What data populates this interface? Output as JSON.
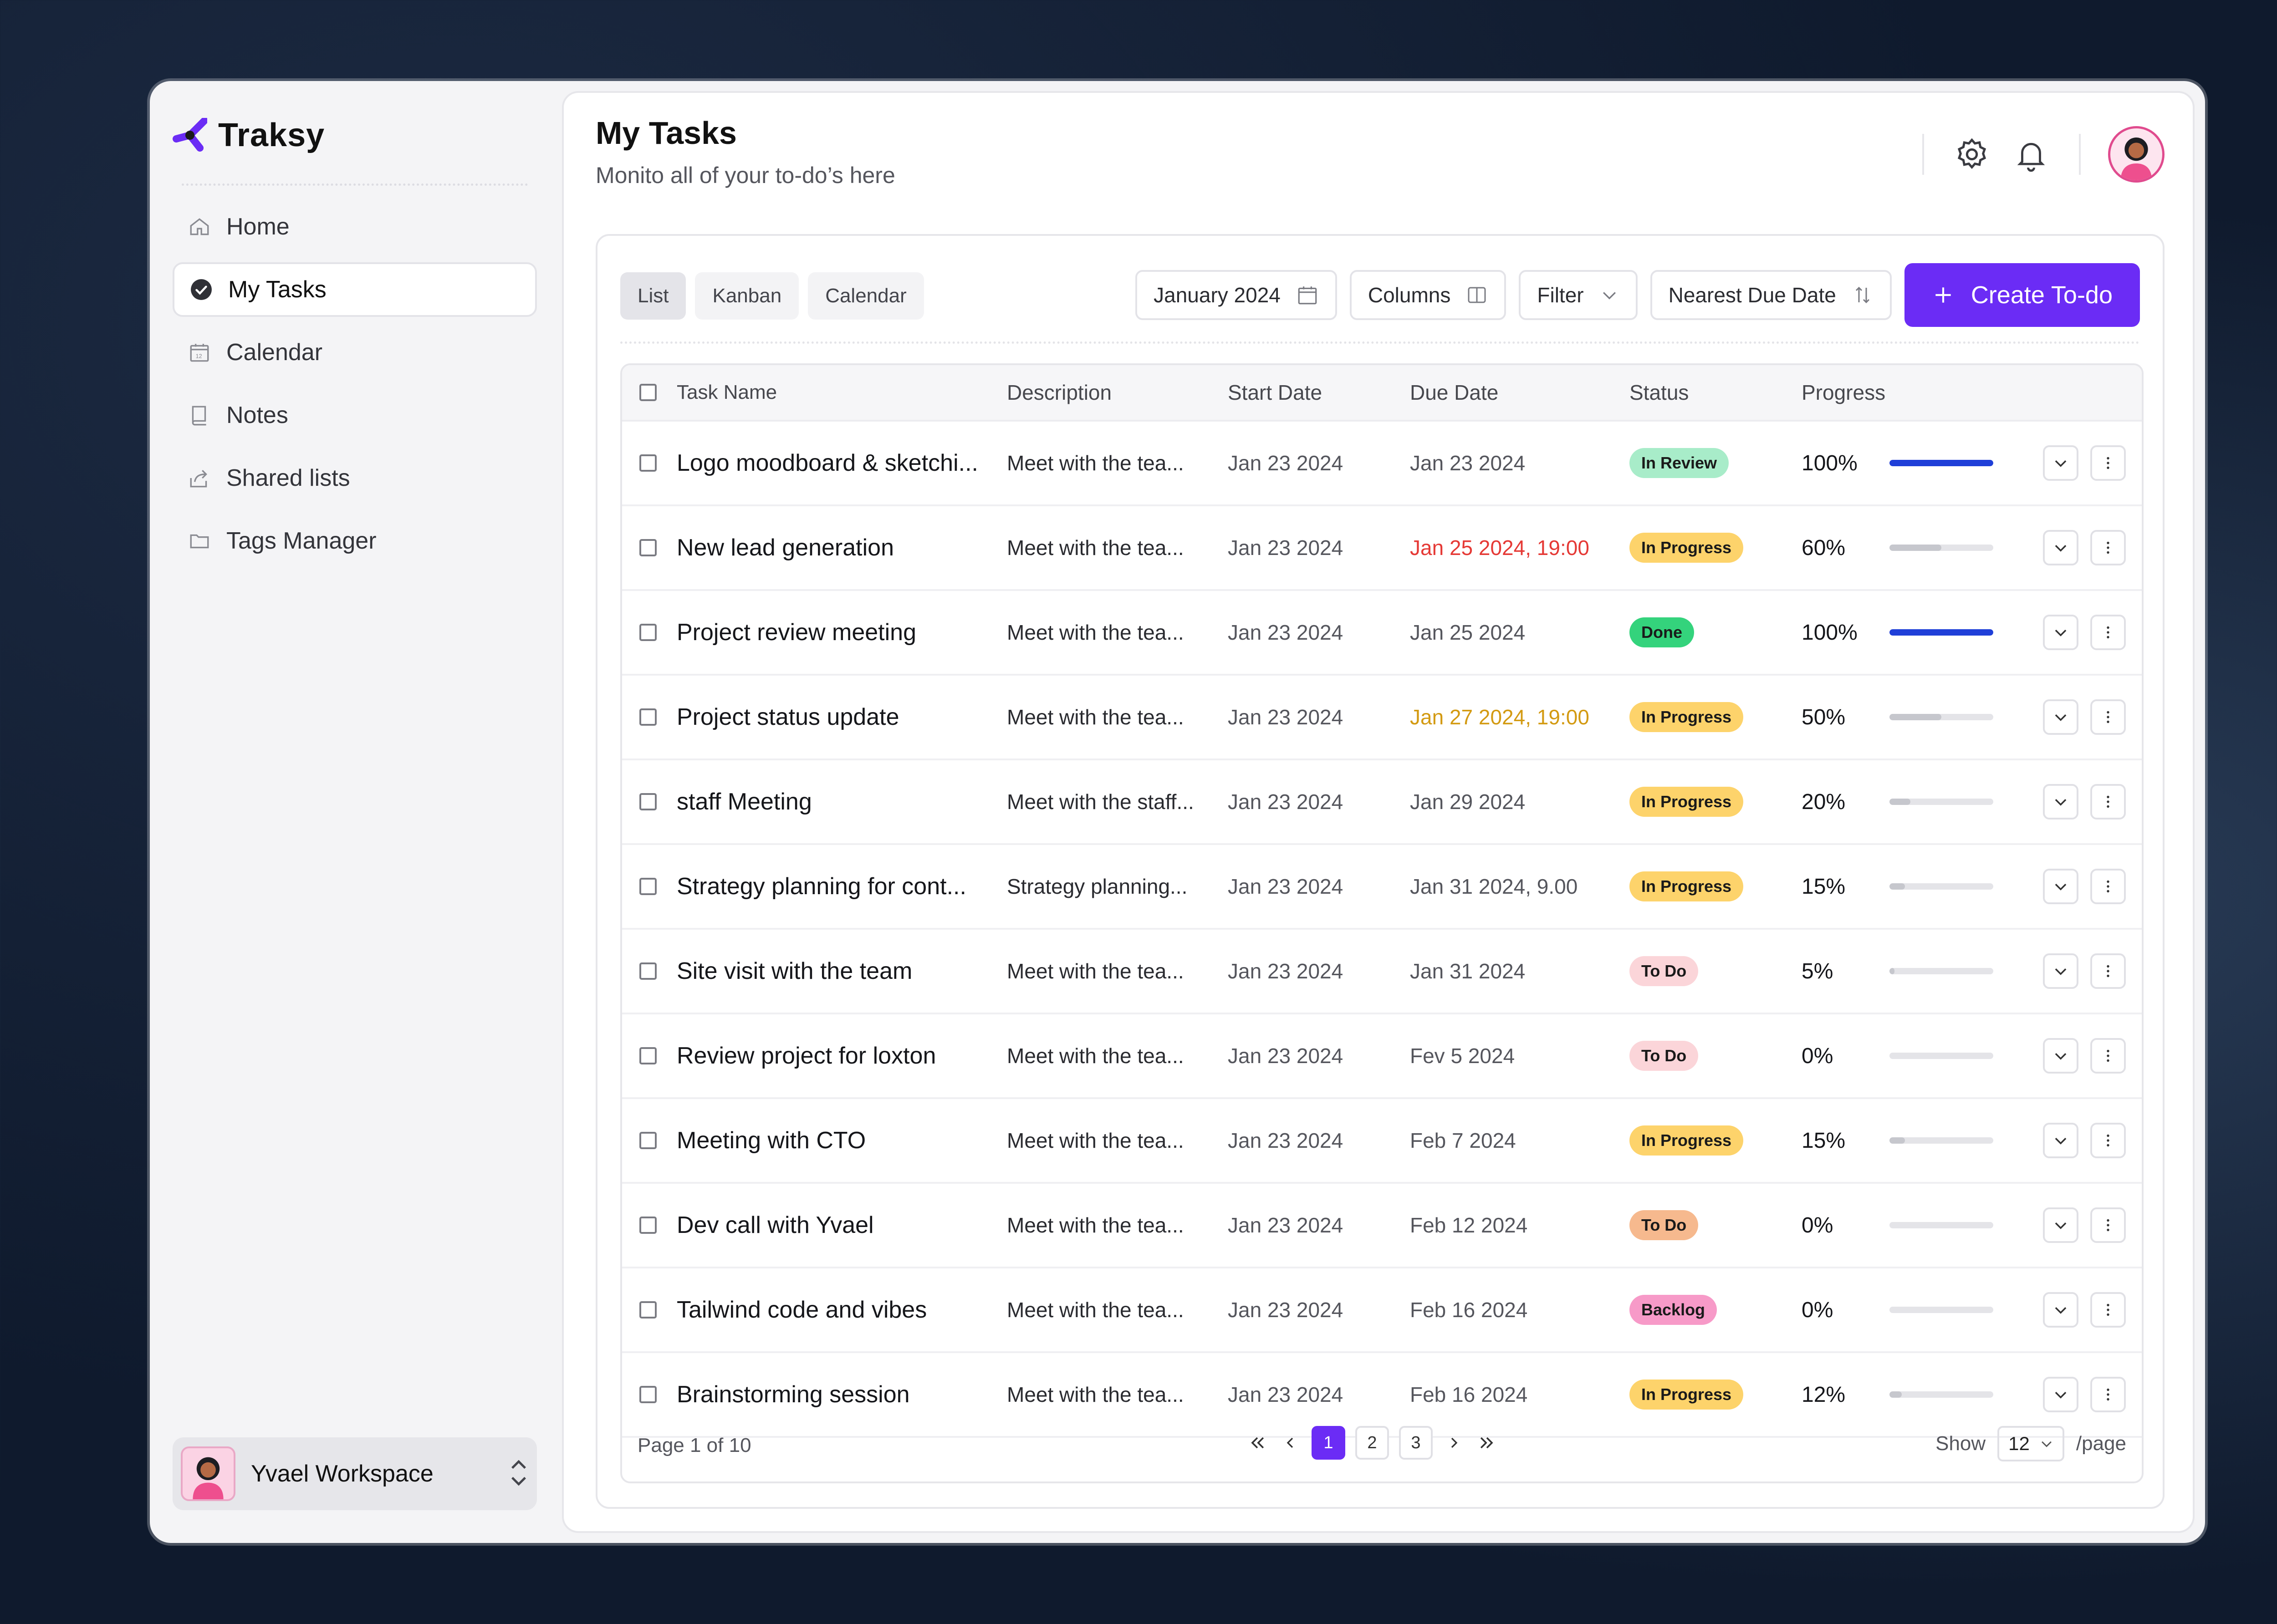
{
  "app": {
    "name": "Traksy"
  },
  "sidebar": {
    "items": [
      {
        "label": "Home",
        "icon": "home-icon"
      },
      {
        "label": "My Tasks",
        "icon": "check-circle-icon",
        "active": true
      },
      {
        "label": "Calendar",
        "icon": "calendar-icon"
      },
      {
        "label": "Notes",
        "icon": "notebook-icon"
      },
      {
        "label": "Shared lists",
        "icon": "share-icon"
      },
      {
        "label": "Tags Manager",
        "icon": "folder-icon"
      }
    ],
    "workspace": {
      "name": "Yvael Workspace"
    }
  },
  "header": {
    "title": "My Tasks",
    "subtitle": "Monito all of your to-do’s here"
  },
  "toolbar": {
    "views": [
      "List",
      "Kanban",
      "Calendar"
    ],
    "active_view": "List",
    "month": "January 2024",
    "columns_label": "Columns",
    "filter_label": "Filter",
    "sort_label": "Nearest Due Date",
    "create_label": "Create To-do"
  },
  "table": {
    "headers": {
      "name": "Task Name",
      "description": "Description",
      "start": "Start Date",
      "due": "Due Date",
      "status": "Status",
      "progress": "Progress"
    },
    "rows": [
      {
        "name": "Logo moodboard & sketchi...",
        "desc": "Meet with the tea...",
        "start": "Jan 23 2024",
        "due": "Jan 23 2024",
        "due_tone": "normal",
        "status": "In Review",
        "progress_label": "100%",
        "progress": 1.0
      },
      {
        "name": "New lead generation",
        "desc": "Meet with the tea...",
        "start": "Jan 23 2024",
        "due": "Jan 25 2024, 19:00",
        "due_tone": "red",
        "status": "In Progress",
        "progress_label": "60%",
        "progress": 0.5
      },
      {
        "name": "Project review meeting",
        "desc": "Meet with the tea...",
        "start": "Jan 23 2024",
        "due": "Jan 25 2024",
        "due_tone": "normal",
        "status": "Done",
        "progress_label": "100%",
        "progress": 1.0
      },
      {
        "name": "Project status update",
        "desc": "Meet with the tea...",
        "start": "Jan 23 2024",
        "due": "Jan 27 2024, 19:00",
        "due_tone": "amber",
        "status": "In Progress",
        "progress_label": "50%",
        "progress": 0.5
      },
      {
        "name": "staff Meeting",
        "desc": "Meet with the staff...",
        "start": "Jan 23 2024",
        "due": "Jan 29 2024",
        "due_tone": "normal",
        "status": "In Progress",
        "progress_label": "20%",
        "progress": 0.2
      },
      {
        "name": "Strategy planning for cont...",
        "desc": "Strategy planning...",
        "start": "Jan 23 2024",
        "due": "Jan 31 2024, 9.00",
        "due_tone": "normal",
        "status": "In Progress",
        "progress_label": "15%",
        "progress": 0.15
      },
      {
        "name": "Site visit with the team",
        "desc": "Meet with the tea...",
        "start": "Jan 23 2024",
        "due": "Jan 31 2024",
        "due_tone": "normal",
        "status": "To Do",
        "progress_label": "5%",
        "progress": 0.05
      },
      {
        "name": "Review project for loxton",
        "desc": "Meet with the tea...",
        "start": "Jan 23 2024",
        "due": "Fev 5 2024",
        "due_tone": "normal",
        "status": "To Do",
        "progress_label": "0%",
        "progress": 0
      },
      {
        "name": "Meeting with CTO",
        "desc": "Meet with the tea...",
        "start": "Jan 23 2024",
        "due": "Feb 7 2024",
        "due_tone": "normal",
        "status": "In Progress",
        "progress_label": "15%",
        "progress": 0.15
      },
      {
        "name": "Dev call with Yvael",
        "desc": "Meet with the tea...",
        "start": "Jan 23 2024",
        "due": "Feb 12 2024",
        "due_tone": "normal",
        "status": "To Do",
        "status_variant": "orange",
        "progress_label": "0%",
        "progress": 0
      },
      {
        "name": "Tailwind code and vibes",
        "desc": "Meet with the tea...",
        "start": "Jan 23 2024",
        "due": "Feb 16 2024",
        "due_tone": "normal",
        "status": "Backlog",
        "progress_label": "0%",
        "progress": 0
      },
      {
        "name": "Brainstorming session",
        "desc": "Meet with the tea...",
        "start": "Jan 23 2024",
        "due": "Feb 16 2024",
        "due_tone": "normal",
        "status": "In Progress",
        "progress_label": "12%",
        "progress": 0.12
      }
    ]
  },
  "pagination": {
    "page_info": "Page 1 of 10",
    "pages": [
      "1",
      "2",
      "3"
    ],
    "current": "1",
    "show_label": "Show",
    "per_page": "12",
    "per_page_suffix": "/page"
  },
  "colors": {
    "accent": "#6b2cf5",
    "bar_full": "#1f3fd8",
    "bar_partial": "#c6c7cd",
    "status": {
      "In Review": "#a8ecc9",
      "In Progress": "#fdd36b",
      "Done": "#34d37c",
      "To Do": "#fbd5d9",
      "To Do orange": "#f6b98e",
      "Backlog": "#f79ac8"
    }
  }
}
